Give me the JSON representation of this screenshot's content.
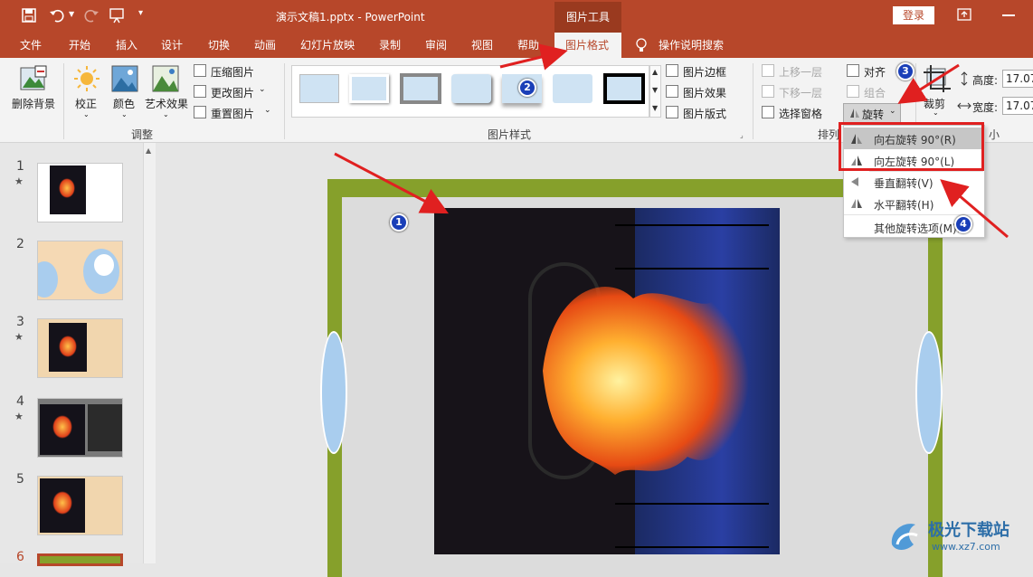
{
  "title": {
    "document": "演示文稿1.pptx",
    "separator": "-",
    "app": "PowerPoint",
    "context_tool": "图片工具",
    "login": "登录"
  },
  "tabs": [
    "文件",
    "开始",
    "插入",
    "设计",
    "切换",
    "动画",
    "幻灯片放映",
    "录制",
    "审阅",
    "视图",
    "帮助",
    "图片格式",
    "操作说明搜索"
  ],
  "active_tab": "图片格式",
  "ribbon": {
    "remove_bg": "删除背景",
    "correct": "校正",
    "color": "颜色",
    "artistic": "艺术效果",
    "compress": "压缩图片",
    "change": "更改图片",
    "reset": "重置图片",
    "group_adjust": "调整",
    "group_styles": "图片样式",
    "border": "图片边框",
    "effects": "图片效果",
    "layout": "图片版式",
    "bring_forward": "上移一层",
    "send_backward": "下移一层",
    "selection_pane": "选择窗格",
    "align": "对齐",
    "group": "组合",
    "rotate": "旋转",
    "group_arrange": "排列",
    "crop": "裁剪",
    "height_label": "高度:",
    "height_value": "17.07",
    "width_label": "宽度:",
    "width_value": "17.07",
    "group_size_tail": "小"
  },
  "rotate_menu": [
    {
      "label": "向右旋转 90°(R)"
    },
    {
      "label": "向左旋转 90°(L)"
    },
    {
      "label": "垂直翻转(V)"
    },
    {
      "label": "水平翻转(H)"
    },
    {
      "label": "其他旋转选项(M)..."
    }
  ],
  "slides": [
    {
      "num": "1",
      "star": "★"
    },
    {
      "num": "2",
      "star": ""
    },
    {
      "num": "3",
      "star": "★"
    },
    {
      "num": "4",
      "star": "★"
    },
    {
      "num": "5",
      "star": ""
    },
    {
      "num": "6",
      "star": ""
    }
  ],
  "badges": [
    "1",
    "2",
    "3",
    "4"
  ],
  "watermark": {
    "name": "极光下载站",
    "url": "www.xz7.com"
  },
  "colors": {
    "accent": "#b7472a",
    "arrow": "#e02020",
    "badge": "#1a3fb8",
    "slide_frame": "#86a02b"
  }
}
